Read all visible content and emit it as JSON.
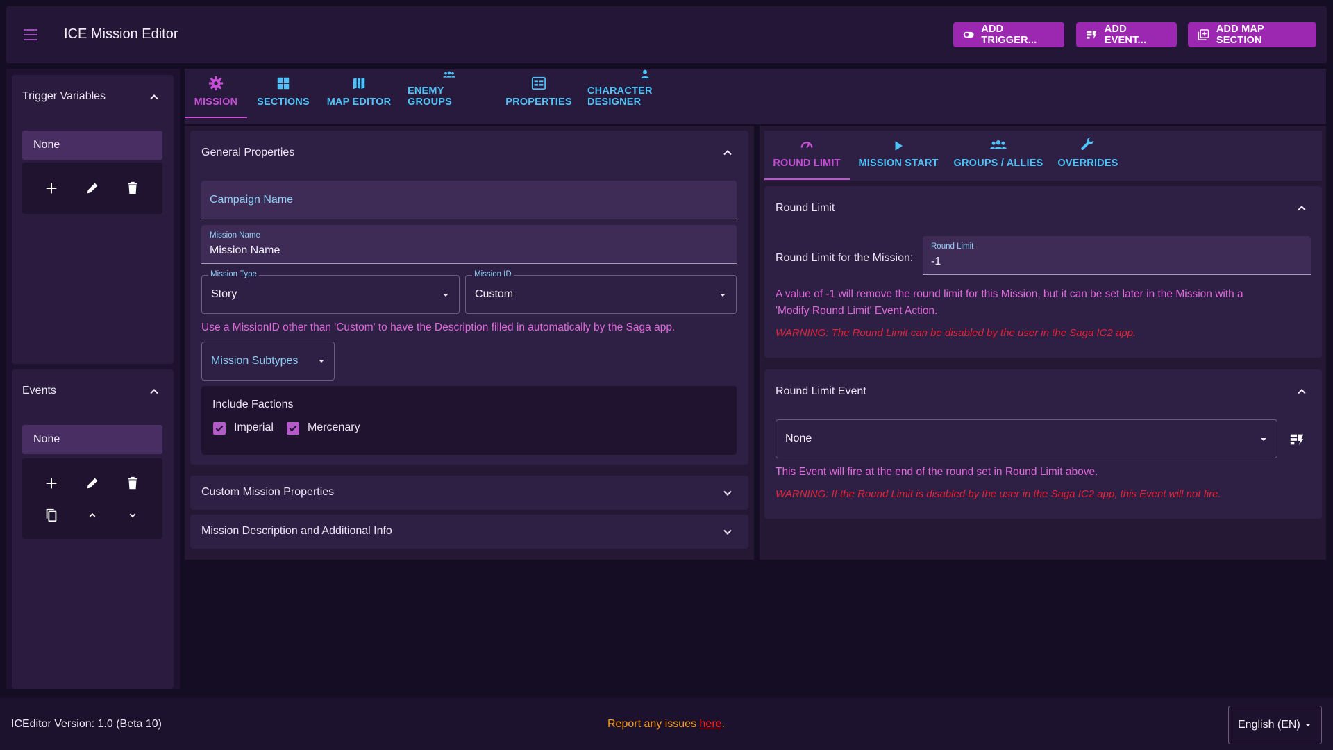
{
  "app": {
    "title": "ICE Mission Editor",
    "buttons": {
      "add_trigger": "ADD TRIGGER...",
      "add_event": "ADD EVENT...",
      "add_map_section": "ADD MAP SECTION"
    }
  },
  "sidebar": {
    "trigger_variables": {
      "title": "Trigger Variables",
      "selected": "None"
    },
    "events": {
      "title": "Events",
      "selected": "None"
    }
  },
  "main_tabs": {
    "mission": "MISSION",
    "sections": "SECTIONS",
    "map_editor": "MAP EDITOR",
    "enemy_groups": "ENEMY GROUPS",
    "properties": "PROPERTIES",
    "character_designer": "CHARACTER DESIGNER"
  },
  "general": {
    "title": "General Properties",
    "campaign_name_placeholder": "Campaign Name",
    "mission_name_label": "Mission Name",
    "mission_name_value": "Mission Name",
    "mission_type_label": "Mission Type",
    "mission_type_value": "Story",
    "mission_id_label": "Mission ID",
    "mission_id_value": "Custom",
    "mission_id_hint": "Use a MissionID other than 'Custom' to have the Description filled in automatically by the Saga app.",
    "mission_subtypes": "Mission Subtypes",
    "factions_title": "Include Factions",
    "faction_imperial": "Imperial",
    "faction_mercenary": "Mercenary"
  },
  "custom_props": {
    "title": "Custom Mission Properties"
  },
  "description": {
    "title": "Mission Description and Additional Info"
  },
  "right_tabs": {
    "round_limit": "ROUND LIMIT",
    "mission_start": "MISSION START",
    "groups_allies": "GROUPS / ALLIES",
    "overrides": "OVERRIDES"
  },
  "round_limit": {
    "title": "Round Limit",
    "row_label": "Round Limit for the Mission:",
    "field_label": "Round Limit",
    "field_value": "-1",
    "note_line1": "A value of -1 will remove the round limit for this Mission, but it can be set later in the Mission with a",
    "note_line2": "'Modify Round Limit' Event Action.",
    "warning": "WARNING: The Round Limit can be disabled by the user in the Saga IC2 app."
  },
  "round_limit_event": {
    "title": "Round Limit Event",
    "select_value": "None",
    "note": "This Event will fire at the end of the round set in Round Limit above.",
    "warning": "WARNING: If the Round Limit is disabled by the user in the Saga IC2 app, this Event will not fire."
  },
  "footer": {
    "version": "ICEditor Version: 1.0 (Beta 10)",
    "report_prefix": "Report any issues ",
    "report_link": "here",
    "report_suffix": ".",
    "language": "English (EN)"
  },
  "colors": {
    "accent": "#9c27b0",
    "tab_blue": "#4fc3f7",
    "active_tab": "#c64fd6",
    "warning": "#e0253a",
    "hint": "#df6ad9"
  }
}
